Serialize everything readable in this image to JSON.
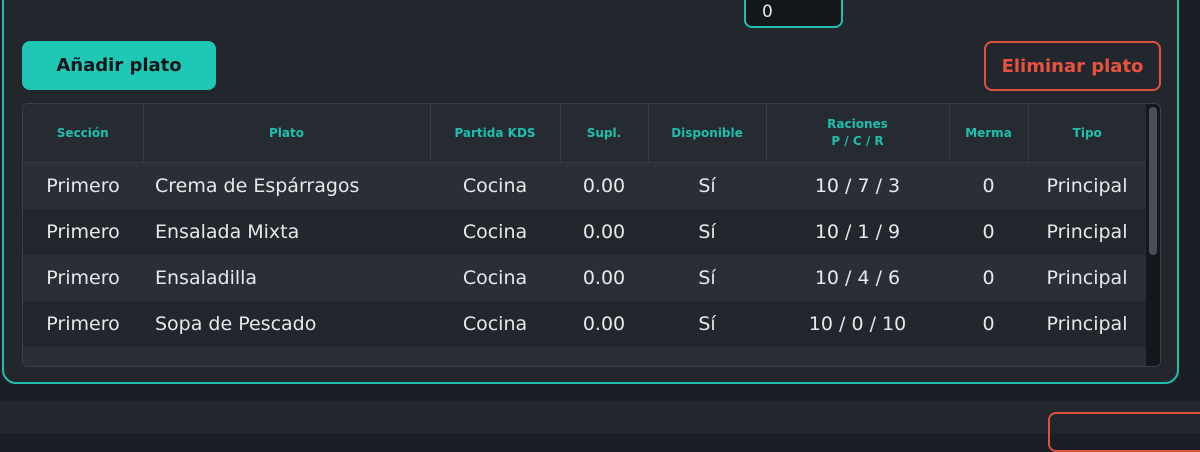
{
  "top_field": {
    "value": "0"
  },
  "actions": {
    "add_label": "Añadir plato",
    "delete_label": "Eliminar plato"
  },
  "table": {
    "headers": [
      "Sección",
      "Plato",
      "Partida KDS",
      "Supl.",
      "Disponible",
      "Raciones",
      "Merma",
      "Tipo"
    ],
    "raciones_subheader": "P / C / R",
    "rows": [
      [
        "Primero",
        "Crema de Espárragos",
        "Cocina",
        "0.00",
        "Sí",
        "10 / 7 / 3",
        "0",
        "Principal"
      ],
      [
        "Primero",
        "Ensalada Mixta",
        "Cocina",
        "0.00",
        "Sí",
        "10 / 1 / 9",
        "0",
        "Principal"
      ],
      [
        "Primero",
        "Ensaladilla",
        "Cocina",
        "0.00",
        "Sí",
        "10 / 4 / 6",
        "0",
        "Principal"
      ],
      [
        "Primero",
        "Sopa de Pescado",
        "Cocina",
        "0.00",
        "Sí",
        "10 / 0 / 10",
        "0",
        "Principal"
      ],
      [
        "",
        "",
        "",
        "",
        "",
        "",
        "",
        ""
      ]
    ]
  },
  "colors": {
    "accent": "#1fbfae",
    "danger": "#e0503f",
    "background": "#1b1e24",
    "panel": "#22262d"
  }
}
